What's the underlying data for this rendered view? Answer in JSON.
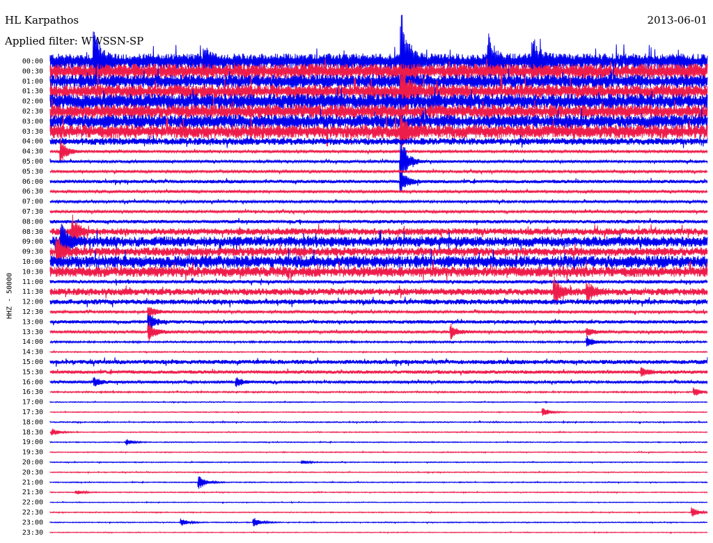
{
  "header": {
    "station": "HL Karpathos",
    "filter": "Applied filter: WWSSN-SP",
    "date": "2013-06-01",
    "channel": "HHZ - 50000"
  },
  "colors": {
    "trace_a": "#0000ee",
    "trace_b": "#ee1c4a",
    "background": "#ffffff",
    "text": "#000000"
  },
  "chart_data": {
    "type": "line",
    "subtype": "helicorder",
    "title": "HL Karpathos",
    "subtitle": "Applied filter: WWSSN-SP",
    "ylabel": "HHZ - 50000",
    "xlabel": "",
    "grid": false,
    "legend": "none",
    "row_labels": [
      "00:00",
      "00:30",
      "01:00",
      "01:30",
      "02:00",
      "02:30",
      "03:00",
      "03:30",
      "04:00",
      "04:30",
      "05:00",
      "05:30",
      "06:00",
      "06:30",
      "07:00",
      "07:30",
      "08:00",
      "08:30",
      "09:00",
      "09:30",
      "10:00",
      "10:30",
      "11:00",
      "11:30",
      "12:00",
      "12:30",
      "13:00",
      "13:30",
      "14:00",
      "14:30",
      "15:00",
      "15:30",
      "16:00",
      "16:30",
      "17:00",
      "17:30",
      "18:00",
      "18:30",
      "19:00",
      "19:30",
      "20:00",
      "20:30",
      "21:00",
      "21:30",
      "22:00",
      "22:30",
      "23:00",
      "23:30"
    ],
    "row_colors": [
      "blue",
      "red",
      "blue",
      "red",
      "blue",
      "red",
      "blue",
      "red",
      "blue",
      "red",
      "blue",
      "red",
      "blue",
      "red",
      "blue",
      "red",
      "blue",
      "red",
      "blue",
      "red",
      "blue",
      "red",
      "blue",
      "red",
      "blue",
      "red",
      "blue",
      "red",
      "blue",
      "red",
      "blue",
      "red",
      "blue",
      "red",
      "blue",
      "red",
      "blue",
      "red",
      "blue",
      "red",
      "blue",
      "red",
      "blue",
      "red",
      "blue",
      "red",
      "blue",
      "red"
    ],
    "row_noise_level": [
      9,
      9,
      8,
      8,
      9,
      8,
      8,
      8,
      4,
      1.5,
      1.5,
      1.5,
      2,
      1.5,
      1.5,
      1.5,
      2,
      4,
      6,
      5,
      7,
      6,
      2,
      4,
      3,
      1.5,
      2,
      1.5,
      1,
      0.6,
      2.5,
      2,
      1.5,
      0.8,
      0.5,
      0.5,
      0.6,
      0.5,
      0.5,
      0.5,
      0.5,
      0.5,
      0.5,
      0.5,
      0.4,
      0.5,
      0.5,
      0.4
    ],
    "events": [
      {
        "row": 0,
        "minute": 2,
        "amp": 40
      },
      {
        "row": 0,
        "minute": 16,
        "amp": 80
      },
      {
        "row": 0,
        "minute": 7,
        "amp": 18
      },
      {
        "row": 0,
        "minute": 20,
        "amp": 30
      },
      {
        "row": 0,
        "minute": 22,
        "amp": 30
      },
      {
        "row": 3,
        "minute": 16,
        "amp": 30
      },
      {
        "row": 7,
        "minute": 16,
        "amp": 20
      },
      {
        "row": 9,
        "minute": 0.5,
        "amp": 15
      },
      {
        "row": 10,
        "minute": 16,
        "amp": 35
      },
      {
        "row": 12,
        "minute": 16,
        "amp": 15
      },
      {
        "row": 17,
        "minute": 1,
        "amp": 20
      },
      {
        "row": 18,
        "minute": 0.5,
        "amp": 25
      },
      {
        "row": 19,
        "minute": 0.3,
        "amp": 18
      },
      {
        "row": 23,
        "minute": 23,
        "amp": 18
      },
      {
        "row": 23,
        "minute": 24.5,
        "amp": 14
      },
      {
        "row": 25,
        "minute": 4.5,
        "amp": 8
      },
      {
        "row": 26,
        "minute": 4.5,
        "amp": 12
      },
      {
        "row": 27,
        "minute": 4.5,
        "amp": 14
      },
      {
        "row": 27,
        "minute": 18.3,
        "amp": 10
      },
      {
        "row": 27,
        "minute": 24.5,
        "amp": 6
      },
      {
        "row": 28,
        "minute": 24.5,
        "amp": 8
      },
      {
        "row": 31,
        "minute": 27,
        "amp": 6
      },
      {
        "row": 32,
        "minute": 2,
        "amp": 6
      },
      {
        "row": 32,
        "minute": 8.5,
        "amp": 6
      },
      {
        "row": 33,
        "minute": 29.4,
        "amp": 6
      },
      {
        "row": 35,
        "minute": 22.5,
        "amp": 6
      },
      {
        "row": 37,
        "minute": 0.1,
        "amp": 5
      },
      {
        "row": 38,
        "minute": 3.5,
        "amp": 4
      },
      {
        "row": 40,
        "minute": 11.5,
        "amp": 3
      },
      {
        "row": 42,
        "minute": 6.8,
        "amp": 10
      },
      {
        "row": 43,
        "minute": 1.2,
        "amp": 3
      },
      {
        "row": 45,
        "minute": 29.3,
        "amp": 7
      },
      {
        "row": 46,
        "minute": 6,
        "amp": 5
      },
      {
        "row": 46,
        "minute": 9.3,
        "amp": 7
      }
    ]
  }
}
